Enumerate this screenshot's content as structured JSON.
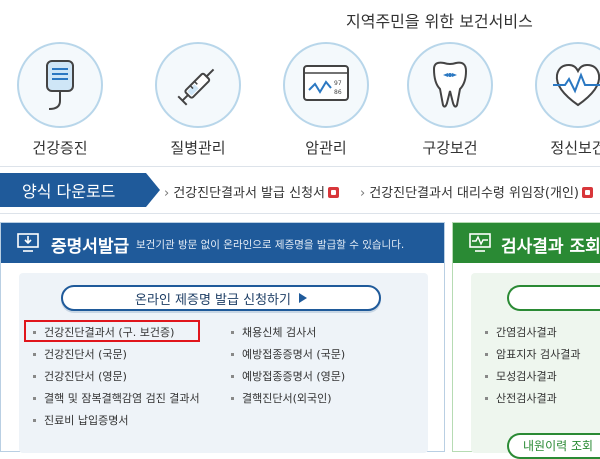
{
  "header": {
    "title": "지역주민을 위한 보건서비스"
  },
  "services": [
    {
      "label": "건강증진",
      "icon": "iv-bag-icon"
    },
    {
      "label": "질병관리",
      "icon": "syringe-icon"
    },
    {
      "label": "암관리",
      "icon": "monitor-chart-icon"
    },
    {
      "label": "구강보건",
      "icon": "tooth-icon"
    },
    {
      "label": "정신보건",
      "icon": "heart-pulse-icon"
    }
  ],
  "downloads": {
    "title": "양식 다운로드",
    "items": [
      "건강진단결과서 발급 신청서",
      "건강진단결과서 대리수령 위임장(개인)"
    ]
  },
  "certificate": {
    "title": "증명서발급",
    "description": "보건기관 방문 없이 온라인으로 제증명을 발급할 수 있습니다.",
    "apply_button": "온라인 제증명 발급 신청하기",
    "left_items": [
      "건강진단결과서 (구. 보건증)",
      "건강진단서 (국문)",
      "건강진단서 (영문)",
      "결핵 및 잠복결핵감염 검진 결과서",
      "진료비 납입증명서"
    ],
    "right_items": [
      "채용신체 검사서",
      "예방접종증명서 (국문)",
      "예방접종증명서 (영문)",
      "결핵진단서(외국인)"
    ]
  },
  "results": {
    "title": "검사결과 조회",
    "items": [
      "간염검사결과",
      "암표지자 검사결과",
      "모성검사결과",
      "산전검사결과"
    ],
    "bottom_pill": "내원이력 조회"
  },
  "colors": {
    "primary_blue": "#1f5a9a",
    "primary_green": "#2a8a34",
    "highlight_red": "#e0151c"
  }
}
